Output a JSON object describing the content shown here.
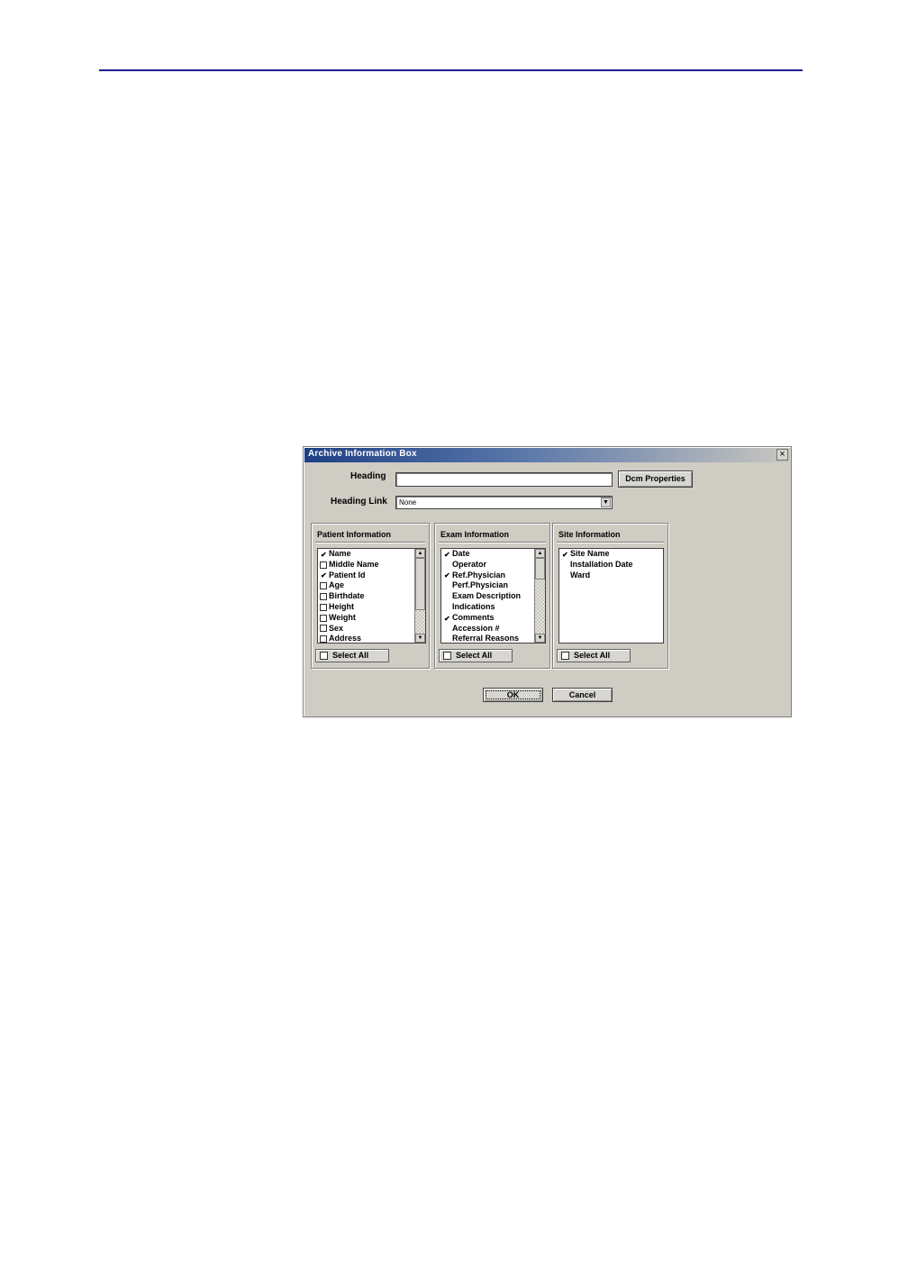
{
  "dialog": {
    "title": "Archive Information Box",
    "close_glyph": "×"
  },
  "form": {
    "heading_label": "Heading",
    "heading_value": "",
    "heading_link_label": "Heading Link",
    "heading_link_value": "None",
    "dcm_properties_label": "Dcm Properties"
  },
  "groups": {
    "patient": {
      "title": "Patient Information",
      "items": [
        {
          "label": "Name",
          "checked": true
        },
        {
          "label": "Middle Name",
          "checked": false
        },
        {
          "label": "Patient Id",
          "checked": true
        },
        {
          "label": "Age",
          "checked": false
        },
        {
          "label": "Birthdate",
          "checked": false
        },
        {
          "label": "Height",
          "checked": false
        },
        {
          "label": "Weight",
          "checked": false
        },
        {
          "label": "Sex",
          "checked": false
        },
        {
          "label": "Address",
          "checked": false
        }
      ],
      "select_all_label": "Select All"
    },
    "exam": {
      "title": "Exam Information",
      "items": [
        {
          "label": "Date",
          "checked": true
        },
        {
          "label": "Operator",
          "checked": false
        },
        {
          "label": "Ref.Physician",
          "checked": true
        },
        {
          "label": "Perf.Physician",
          "checked": false
        },
        {
          "label": "Exam Description",
          "checked": false
        },
        {
          "label": "Indications",
          "checked": false
        },
        {
          "label": "Comments",
          "checked": true
        },
        {
          "label": "Accession #",
          "checked": false
        },
        {
          "label": "Referral Reasons",
          "checked": false
        }
      ],
      "select_all_label": "Select All"
    },
    "site": {
      "title": "Site Information",
      "items": [
        {
          "label": "Site Name",
          "checked": true
        },
        {
          "label": "Installation Date",
          "checked": false
        },
        {
          "label": "Ward",
          "checked": false
        }
      ],
      "select_all_label": "Select All"
    }
  },
  "buttons": {
    "ok_label": "OK",
    "cancel_label": "Cancel"
  },
  "colors": {
    "title_bar": "#1d3f86",
    "dialog_bg": "#cfccc4",
    "page_rule": "#1f1f8f"
  }
}
